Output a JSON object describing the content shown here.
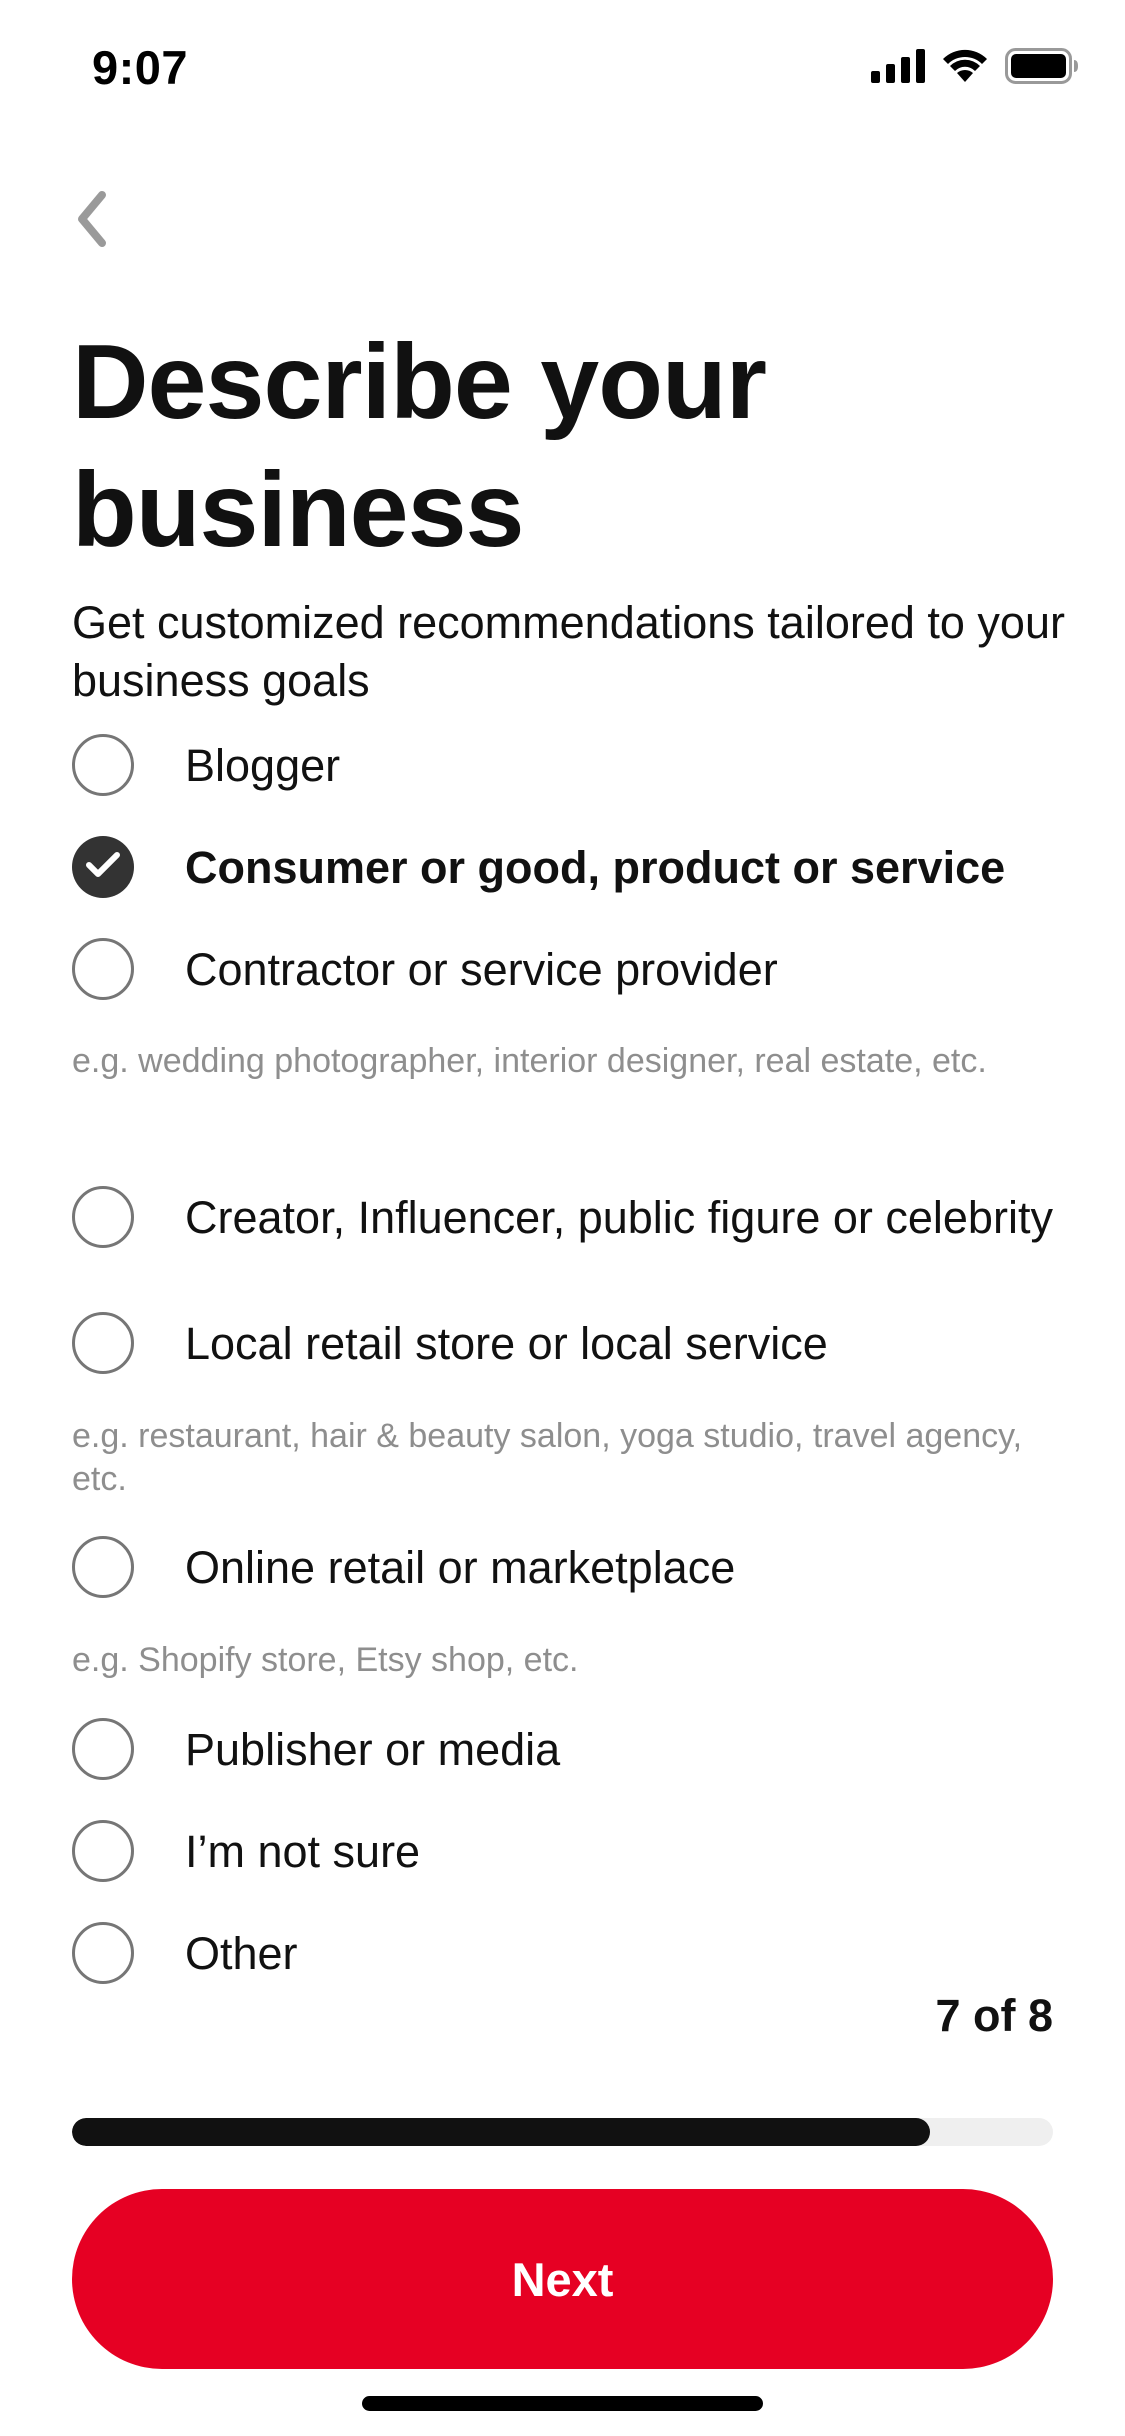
{
  "status_bar": {
    "time": "9:07",
    "icons": [
      "cellular-signal-icon",
      "wifi-icon",
      "battery-icon"
    ]
  },
  "header": {
    "back_icon": "chevron-left-icon"
  },
  "page": {
    "title": "Describe your business",
    "subtitle": "Get customized recommendations tailored to your business goals"
  },
  "options": [
    {
      "label": "Blogger",
      "selected": false,
      "hint": ""
    },
    {
      "label": "Consumer or good, product or service",
      "selected": true,
      "hint": ""
    },
    {
      "label": "Contractor or service provider",
      "selected": false,
      "hint": "e.g. wedding photographer, interior designer, real estate, etc."
    },
    {
      "label": "Creator, Influencer, public figure or celebrity",
      "selected": false,
      "hint": ""
    },
    {
      "label": "Local retail store or local service",
      "selected": false,
      "hint": "e.g. restaurant, hair & beauty salon, yoga studio, travel agency, etc."
    },
    {
      "label": "Online retail or marketplace",
      "selected": false,
      "hint": "e.g. Shopify store, Etsy shop, etc."
    },
    {
      "label": "Publisher or media",
      "selected": false,
      "hint": ""
    },
    {
      "label": "I’m not sure",
      "selected": false,
      "hint": ""
    },
    {
      "label": "Other",
      "selected": false,
      "hint": ""
    }
  ],
  "progress": {
    "step_label": "7 of 8",
    "current": 7,
    "total": 8,
    "fill_fraction": 0.875
  },
  "footer": {
    "next_label": "Next"
  },
  "colors": {
    "accent": "#e60023",
    "selected_radio": "#333333",
    "progress_fill": "#111111",
    "progress_track": "#efefef",
    "hint_text": "#8e8e8e"
  }
}
